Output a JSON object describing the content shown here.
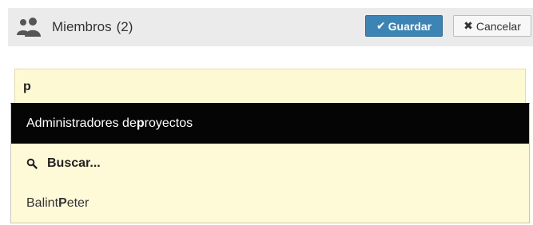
{
  "header": {
    "title": "Miembros",
    "count": "(2)",
    "icon": "members-icon",
    "save_label": "Guardar",
    "cancel_label": "Cancelar"
  },
  "search": {
    "value": "p"
  },
  "dropdown": {
    "items": [
      {
        "prefix": "Administradores de ",
        "match": "p",
        "suffix": "royectos",
        "state": "highlighted"
      },
      {
        "label": "Buscar...",
        "icon": "search-icon"
      },
      {
        "prefix": "Balint ",
        "match": "P",
        "suffix": "eter"
      }
    ]
  },
  "colors": {
    "header_bg": "#ebebeb",
    "save_bg": "#3b84b3",
    "input_bg": "#fdf9d3",
    "highlight_bg": "#050505"
  }
}
